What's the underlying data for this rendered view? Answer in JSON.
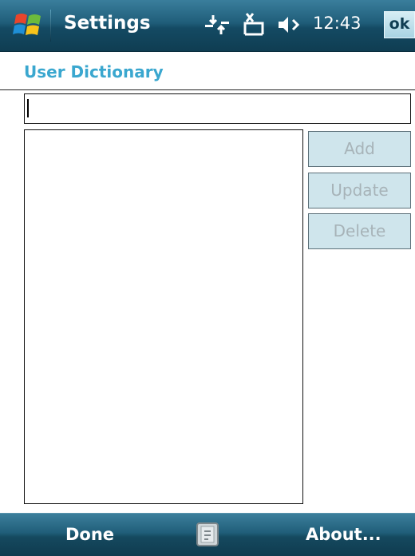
{
  "titlebar": {
    "app_title": "Settings",
    "time": "12:43",
    "ok_label": "ok",
    "icons": [
      "windows-start-icon",
      "connectivity-icon",
      "no-signal-icon",
      "volume-icon"
    ]
  },
  "header": {
    "title": "User Dictionary"
  },
  "input": {
    "value": ""
  },
  "list": {
    "items": []
  },
  "buttons": {
    "add": "Add",
    "update": "Update",
    "delete": "Delete"
  },
  "softkeys": {
    "left": "Done",
    "right": "About...",
    "center_icon": "keyboard-icon"
  },
  "colors": {
    "title_accent": "#3aa7cf",
    "bar_dark": "#144a63",
    "button_fill": "#cfe5ec",
    "disabled_text": "#a7b3b8"
  }
}
